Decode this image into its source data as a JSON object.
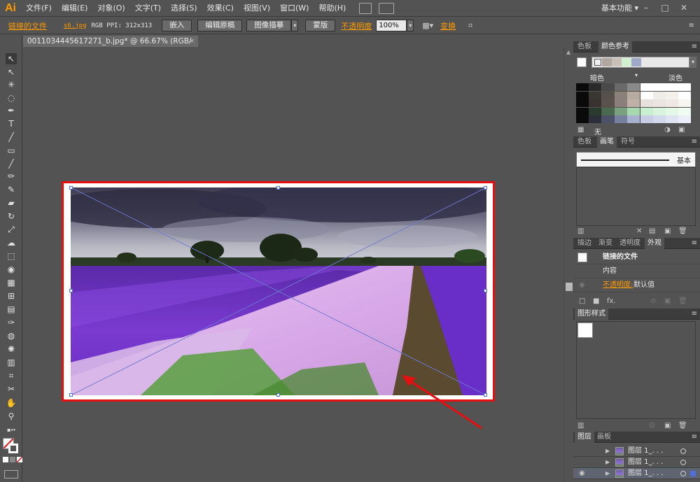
{
  "app": {
    "logo": "Ai"
  },
  "menubar": {
    "items": [
      "文件(F)",
      "编辑(E)",
      "对象(O)",
      "文字(T)",
      "选择(S)",
      "效果(C)",
      "视图(V)",
      "窗口(W)",
      "帮助(H)"
    ],
    "workspace": "基本功能",
    "window_controls": [
      "–",
      "□",
      "✕"
    ]
  },
  "controlbar": {
    "linked_file": "链接的文件",
    "filename": "s6.jpg",
    "color_info": "RGB  PPI: 312x313",
    "embed": "嵌入",
    "edit_original": "编辑原稿",
    "image_trace": "图像描摹",
    "mask": "蒙版",
    "opacity_label": "不透明度",
    "opacity_value": "100%",
    "transform": "变换"
  },
  "document": {
    "tab_title": "0011034445617271_b.jpg* @ 66.67% (RGB/预览)",
    "tab_close": "×"
  },
  "color_guide": {
    "tabs": [
      "色板",
      "颜色参考"
    ],
    "active_tab": "颜色参考",
    "dark_label": "暗色",
    "light_label": "淡色",
    "none_label": "无",
    "harmony_colors": [
      "#f0f0f0",
      "#b0a8a0",
      "#c8c0b8",
      "#d0f0d0",
      "#a0a8c8"
    ],
    "grid_rows": [
      [
        "#0a0a0a",
        "#2a2a2a",
        "#4a4a4a",
        "#6a6a6a",
        "#8a8a8a",
        "#ffffff",
        "#ffffff",
        "#ffffff",
        "#ffffff"
      ],
      [
        "#0a0a0a",
        "#3a3630",
        "#55504a",
        "#8a8078",
        "#b8aca0",
        "#ffffff",
        "#f0ece8",
        "#f4f0ec",
        "#ffffff"
      ],
      [
        "#0a0a0a",
        "#3a3230",
        "#5a504c",
        "#8c7e7a",
        "#c0b0a8",
        "#e8e0dc",
        "#ece4e0",
        "#f0e8e4",
        "#f8f4f2"
      ],
      [
        "#0a0a0a",
        "#2a3a2c",
        "#4a6a50",
        "#7aa080",
        "#a8d8b0",
        "#c8f0d0",
        "#d8f4dc",
        "#e4f8e8",
        "#f0fcf2"
      ],
      [
        "#0a0a0a",
        "#2c2e3a",
        "#4c5068",
        "#7880a0",
        "#a8b0d0",
        "#c8cce4",
        "#d4d8ec",
        "#e0e4f2",
        "#eceef8"
      ]
    ]
  },
  "brushes": {
    "tabs": [
      "色板",
      "画笔",
      "符号"
    ],
    "active_tab": "画笔",
    "brush_name": "基本"
  },
  "appearance": {
    "tabs": [
      "描边",
      "渐变",
      "透明度",
      "外观"
    ],
    "active_tab": "外观",
    "title": "链接的文件",
    "content": "内容",
    "opacity_label": "不透明度:",
    "opacity_value": "默认值",
    "fx": "fx."
  },
  "graphic_styles": {
    "tabs": [
      "图形样式"
    ],
    "active_tab": "图形样式"
  },
  "layers": {
    "tabs": [
      "图层",
      "画板"
    ],
    "active_tab": "图层",
    "rows": [
      {
        "name": "图层 1_. . ."
      },
      {
        "name": "图层 1_. . ."
      },
      {
        "name": "图层 1_. . ."
      }
    ]
  },
  "colors": {
    "accent_orange": "#ff9a00",
    "highlight_red": "#e60e0e",
    "selection_blue": "#4d6fd6",
    "ui_gray": "#535353"
  }
}
